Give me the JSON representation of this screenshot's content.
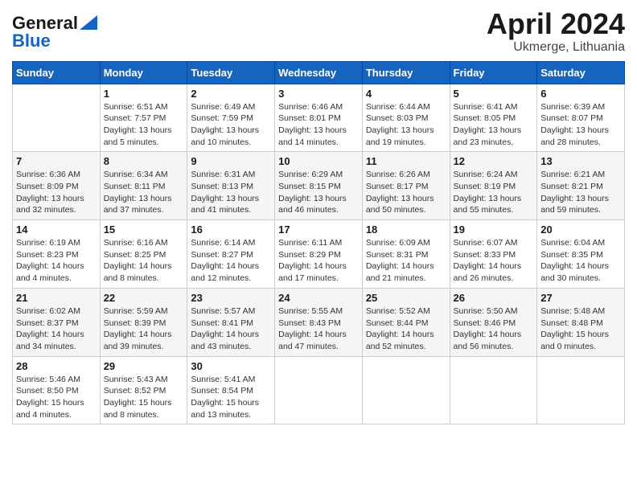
{
  "header": {
    "logo_line1": "General",
    "logo_line2": "Blue",
    "title": "April 2024",
    "subtitle": "Ukmerge, Lithuania"
  },
  "days_of_week": [
    "Sunday",
    "Monday",
    "Tuesday",
    "Wednesday",
    "Thursday",
    "Friday",
    "Saturday"
  ],
  "weeks": [
    [
      {
        "num": "",
        "info": ""
      },
      {
        "num": "1",
        "info": "Sunrise: 6:51 AM\nSunset: 7:57 PM\nDaylight: 13 hours\nand 5 minutes."
      },
      {
        "num": "2",
        "info": "Sunrise: 6:49 AM\nSunset: 7:59 PM\nDaylight: 13 hours\nand 10 minutes."
      },
      {
        "num": "3",
        "info": "Sunrise: 6:46 AM\nSunset: 8:01 PM\nDaylight: 13 hours\nand 14 minutes."
      },
      {
        "num": "4",
        "info": "Sunrise: 6:44 AM\nSunset: 8:03 PM\nDaylight: 13 hours\nand 19 minutes."
      },
      {
        "num": "5",
        "info": "Sunrise: 6:41 AM\nSunset: 8:05 PM\nDaylight: 13 hours\nand 23 minutes."
      },
      {
        "num": "6",
        "info": "Sunrise: 6:39 AM\nSunset: 8:07 PM\nDaylight: 13 hours\nand 28 minutes."
      }
    ],
    [
      {
        "num": "7",
        "info": "Sunrise: 6:36 AM\nSunset: 8:09 PM\nDaylight: 13 hours\nand 32 minutes."
      },
      {
        "num": "8",
        "info": "Sunrise: 6:34 AM\nSunset: 8:11 PM\nDaylight: 13 hours\nand 37 minutes."
      },
      {
        "num": "9",
        "info": "Sunrise: 6:31 AM\nSunset: 8:13 PM\nDaylight: 13 hours\nand 41 minutes."
      },
      {
        "num": "10",
        "info": "Sunrise: 6:29 AM\nSunset: 8:15 PM\nDaylight: 13 hours\nand 46 minutes."
      },
      {
        "num": "11",
        "info": "Sunrise: 6:26 AM\nSunset: 8:17 PM\nDaylight: 13 hours\nand 50 minutes."
      },
      {
        "num": "12",
        "info": "Sunrise: 6:24 AM\nSunset: 8:19 PM\nDaylight: 13 hours\nand 55 minutes."
      },
      {
        "num": "13",
        "info": "Sunrise: 6:21 AM\nSunset: 8:21 PM\nDaylight: 13 hours\nand 59 minutes."
      }
    ],
    [
      {
        "num": "14",
        "info": "Sunrise: 6:19 AM\nSunset: 8:23 PM\nDaylight: 14 hours\nand 4 minutes."
      },
      {
        "num": "15",
        "info": "Sunrise: 6:16 AM\nSunset: 8:25 PM\nDaylight: 14 hours\nand 8 minutes."
      },
      {
        "num": "16",
        "info": "Sunrise: 6:14 AM\nSunset: 8:27 PM\nDaylight: 14 hours\nand 12 minutes."
      },
      {
        "num": "17",
        "info": "Sunrise: 6:11 AM\nSunset: 8:29 PM\nDaylight: 14 hours\nand 17 minutes."
      },
      {
        "num": "18",
        "info": "Sunrise: 6:09 AM\nSunset: 8:31 PM\nDaylight: 14 hours\nand 21 minutes."
      },
      {
        "num": "19",
        "info": "Sunrise: 6:07 AM\nSunset: 8:33 PM\nDaylight: 14 hours\nand 26 minutes."
      },
      {
        "num": "20",
        "info": "Sunrise: 6:04 AM\nSunset: 8:35 PM\nDaylight: 14 hours\nand 30 minutes."
      }
    ],
    [
      {
        "num": "21",
        "info": "Sunrise: 6:02 AM\nSunset: 8:37 PM\nDaylight: 14 hours\nand 34 minutes."
      },
      {
        "num": "22",
        "info": "Sunrise: 5:59 AM\nSunset: 8:39 PM\nDaylight: 14 hours\nand 39 minutes."
      },
      {
        "num": "23",
        "info": "Sunrise: 5:57 AM\nSunset: 8:41 PM\nDaylight: 14 hours\nand 43 minutes."
      },
      {
        "num": "24",
        "info": "Sunrise: 5:55 AM\nSunset: 8:43 PM\nDaylight: 14 hours\nand 47 minutes."
      },
      {
        "num": "25",
        "info": "Sunrise: 5:52 AM\nSunset: 8:44 PM\nDaylight: 14 hours\nand 52 minutes."
      },
      {
        "num": "26",
        "info": "Sunrise: 5:50 AM\nSunset: 8:46 PM\nDaylight: 14 hours\nand 56 minutes."
      },
      {
        "num": "27",
        "info": "Sunrise: 5:48 AM\nSunset: 8:48 PM\nDaylight: 15 hours\nand 0 minutes."
      }
    ],
    [
      {
        "num": "28",
        "info": "Sunrise: 5:46 AM\nSunset: 8:50 PM\nDaylight: 15 hours\nand 4 minutes."
      },
      {
        "num": "29",
        "info": "Sunrise: 5:43 AM\nSunset: 8:52 PM\nDaylight: 15 hours\nand 8 minutes."
      },
      {
        "num": "30",
        "info": "Sunrise: 5:41 AM\nSunset: 8:54 PM\nDaylight: 15 hours\nand 13 minutes."
      },
      {
        "num": "",
        "info": ""
      },
      {
        "num": "",
        "info": ""
      },
      {
        "num": "",
        "info": ""
      },
      {
        "num": "",
        "info": ""
      }
    ]
  ]
}
